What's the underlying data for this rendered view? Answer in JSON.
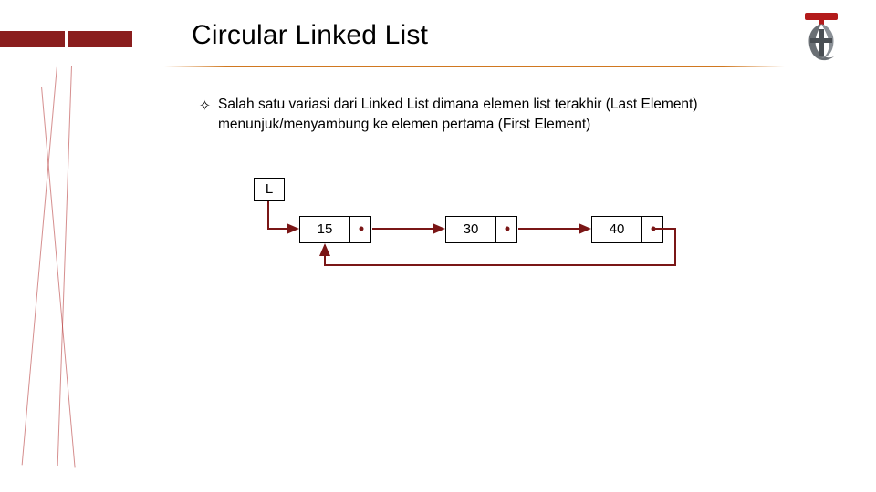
{
  "title": "Circular Linked List",
  "bullet": {
    "marker_glyph": "✧",
    "text": "Salah satu variasi dari Linked List dimana elemen list terakhir (Last Element) menunjuk/menyambung ke elemen pertama (First Element)"
  },
  "diagram": {
    "head_label": "L",
    "nodes": [
      "15",
      "30",
      "40"
    ]
  },
  "colors": {
    "accent": "#8a1e1e",
    "connector": "#7a1616",
    "rule": "#d07820"
  }
}
